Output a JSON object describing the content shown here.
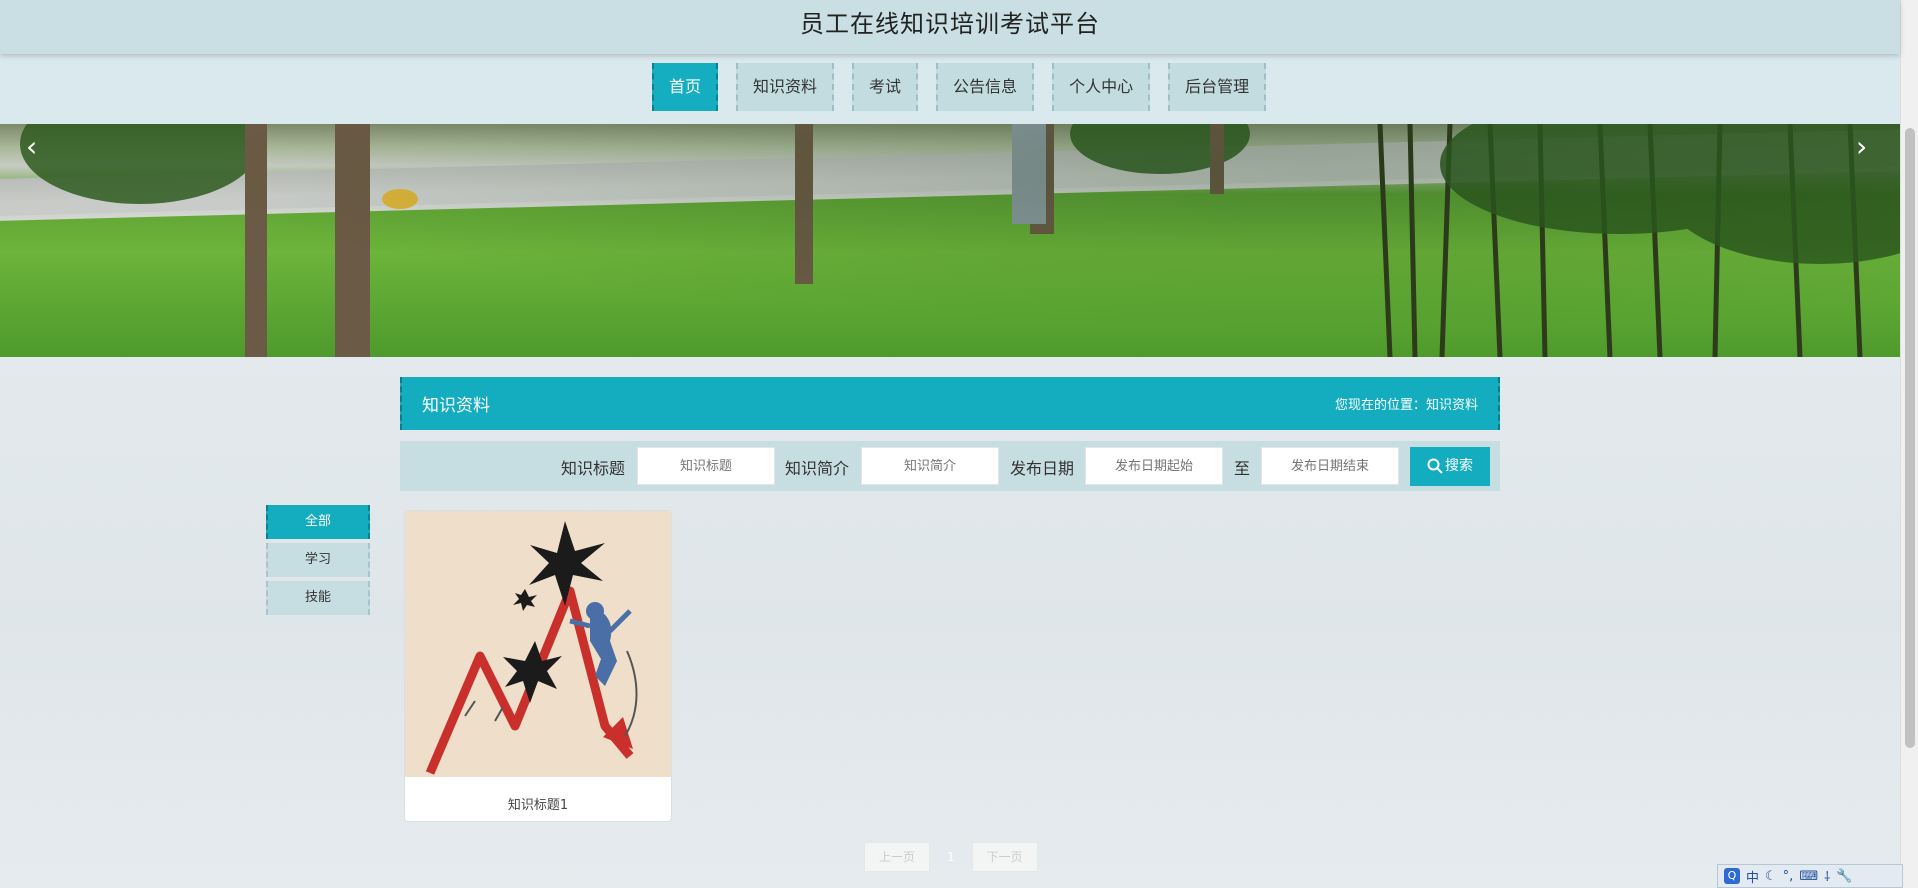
{
  "header": {
    "title": "员工在线知识培训考试平台"
  },
  "nav": {
    "items": [
      {
        "label": "首页"
      },
      {
        "label": "知识资料"
      },
      {
        "label": "考试"
      },
      {
        "label": "公告信息"
      },
      {
        "label": "个人中心"
      },
      {
        "label": "后台管理"
      }
    ]
  },
  "banner": {
    "prev_icon": "chevron-left-icon",
    "next_icon": "chevron-right-icon",
    "prev_glyph": "‹",
    "next_glyph": "›"
  },
  "section": {
    "title": "知识资料",
    "breadcrumb": "您现在的位置：知识资料"
  },
  "search": {
    "title_label": "知识标题",
    "title_placeholder": "知识标题",
    "intro_label": "知识简介",
    "intro_placeholder": "知识简介",
    "date_label": "发布日期",
    "date_start_placeholder": "发布日期起始",
    "to_label": "至",
    "date_end_placeholder": "发布日期结束",
    "button_label": "搜索"
  },
  "categories": [
    {
      "label": "全部"
    },
    {
      "label": "学习"
    },
    {
      "label": "技能"
    }
  ],
  "cards": [
    {
      "title": "知识标题1"
    }
  ],
  "pagination": {
    "prev": "上一页",
    "current": "1",
    "next": "下一页"
  },
  "tray": {
    "items": [
      "中",
      "☾",
      "°,",
      "⌨",
      "⸸",
      "🔧"
    ]
  },
  "colors": {
    "accent": "#14adc0",
    "header_bg": "#c9dfe4",
    "nav_bg": "#d9e9ee"
  }
}
